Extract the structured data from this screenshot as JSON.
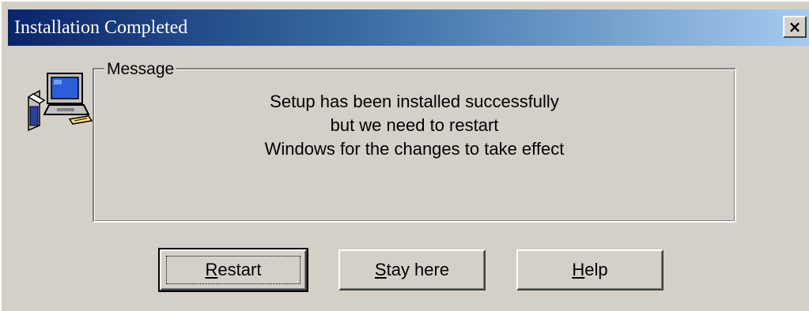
{
  "window": {
    "title": "Installation Completed",
    "close_label": "×"
  },
  "icon": {
    "name": "computer-setup-icon"
  },
  "group": {
    "label": "Message"
  },
  "message": {
    "lines": [
      "Setup has been installed successfully",
      "but we need to restart",
      "Windows for the changes to take effect"
    ]
  },
  "buttons": {
    "restart": {
      "accel": "R",
      "rest": "estart"
    },
    "stay": {
      "accel": "S",
      "rest": "tay here"
    },
    "help": {
      "accel": "H",
      "rest": "elp"
    }
  },
  "colors": {
    "title_start": "#0a246a",
    "title_end": "#a6caf0",
    "face": "#d4d0c8"
  }
}
